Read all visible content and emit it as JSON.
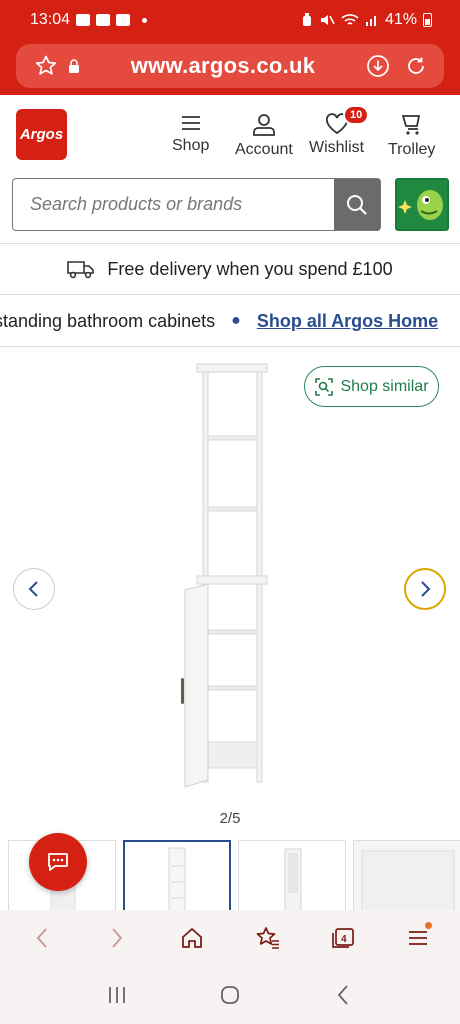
{
  "status_bar": {
    "time": "13:04",
    "battery": "41%"
  },
  "browser": {
    "url": "www.argos.co.uk"
  },
  "header": {
    "logo_text": "Argos",
    "nav": [
      {
        "label": "Shop",
        "icon": "menu-icon"
      },
      {
        "label": "Account",
        "icon": "user-icon"
      },
      {
        "label": "Wishlist",
        "icon": "heart-icon",
        "badge": "10"
      },
      {
        "label": "Trolley",
        "icon": "trolley-icon"
      }
    ]
  },
  "search": {
    "placeholder": "Search products or brands"
  },
  "delivery": {
    "text": "Free delivery when you spend £100"
  },
  "breadcrumb": {
    "current": "standing bathroom cabinets",
    "link": "Shop all Argos Home"
  },
  "gallery": {
    "shop_similar": "Shop similar",
    "counter": "2/5"
  },
  "colors": {
    "brand_red": "#d42114",
    "link_blue": "#2a4d8f",
    "similar_green": "#1e7d4b"
  }
}
